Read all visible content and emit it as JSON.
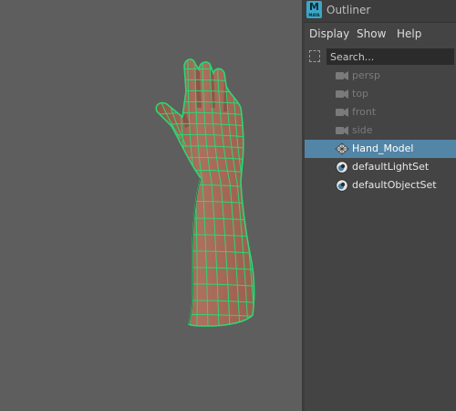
{
  "outliner": {
    "app_logo": "M",
    "app_logo_sub": "MAYA",
    "title": "Outliner",
    "menu": [
      "Display",
      "Show",
      "Help"
    ],
    "search_placeholder": "Search...",
    "items": [
      {
        "label": "persp",
        "icon": "camera-icon",
        "dimmed": true,
        "selected": false
      },
      {
        "label": "top",
        "icon": "camera-icon",
        "dimmed": true,
        "selected": false
      },
      {
        "label": "front",
        "icon": "camera-icon",
        "dimmed": true,
        "selected": false
      },
      {
        "label": "side",
        "icon": "camera-icon",
        "dimmed": true,
        "selected": false
      },
      {
        "label": "Hand_Model",
        "icon": "mesh-transform-icon",
        "dimmed": false,
        "selected": true
      },
      {
        "label": "defaultLightSet",
        "icon": "set-icon",
        "dimmed": false,
        "selected": false
      },
      {
        "label": "defaultObjectSet",
        "icon": "set-icon",
        "dimmed": false,
        "selected": false
      }
    ]
  },
  "viewport": {
    "model": "hand-arm-mesh",
    "colors": {
      "background": "#5e5e5e",
      "skin": "#a86a5a",
      "wireframe": "#2ad873"
    }
  },
  "colors": {
    "selection": "#5285a6",
    "panel": "#444444",
    "logo": "#3aa7c9"
  }
}
